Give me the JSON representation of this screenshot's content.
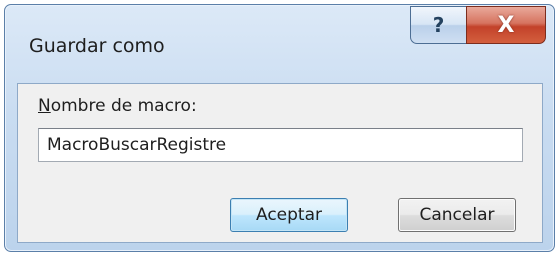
{
  "window": {
    "title": "Guardar como",
    "help_glyph": "?",
    "close_glyph": "X"
  },
  "form": {
    "label_accesskey": "N",
    "label_rest": "ombre de macro:",
    "macro_name_value": "MacroBuscarRegistre"
  },
  "buttons": {
    "ok_label": "Aceptar",
    "cancel_label": "Cancelar"
  },
  "colors": {
    "accent_border": "#3c7fb1",
    "close_red": "#c3422a",
    "frame_blue": "#c9dcf1"
  },
  "icons": {
    "help": "help-icon",
    "close": "close-icon"
  }
}
